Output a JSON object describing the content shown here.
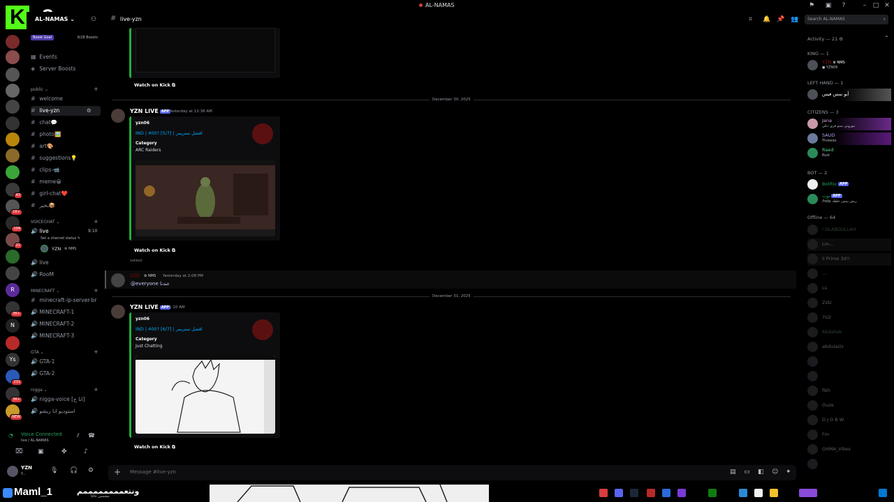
{
  "app": {
    "window_title": "AL-NAMAS",
    "overlay_logo_letter": "K",
    "overlay_logo_number": "8"
  },
  "server": {
    "name": "AL-NAMAS",
    "boost_goal": "Boost Goal",
    "boost_count": "9/28 Boosts",
    "top_links": [
      "Events",
      "Server Boosts"
    ]
  },
  "sidebar": {
    "categories": {
      "public": "public",
      "voicechat": "VOICECHAT",
      "minecraft": "MINECRAFT",
      "gta": "GTA",
      "nigga": "nigga"
    },
    "public_channels": [
      "welcome",
      "live-yzn",
      "chat💬",
      "photo🖼️",
      "art🎨",
      "suggestions💡",
      "clips-📹",
      "meme😀",
      "girl-chat❤️",
      "ـخبر📦"
    ],
    "voice_live": {
      "name": "live",
      "time": "9:10",
      "status": "Set a channel status",
      "member": "YZN",
      "member_tag": "NMS"
    },
    "voice_extra": [
      "live",
      "RooM"
    ],
    "minecraft_channels": [
      "minecraft-ip-server-br",
      "MINECRAFT-1",
      "MINECRAFT-2",
      "MINECRAFT-3"
    ],
    "gta_channels": [
      "GTA-1",
      "GTA-2"
    ],
    "nigga_channels": [
      "nigga-voice [انا ج]",
      "استوديو انا ريشو"
    ]
  },
  "voice_panel": {
    "status": "Voice Connected",
    "location": "live / AL-NAMAS"
  },
  "user_card": {
    "name": "YZN",
    "sub": "Y..."
  },
  "rail_badges": [
    "43",
    "1K+",
    "104",
    "21",
    "3K+",
    "1K+",
    "3K+",
    "231",
    "NEW"
  ],
  "rail_letters": [
    "R",
    "N",
    "Ys"
  ],
  "chat": {
    "channel": "live-yzn",
    "composer_placeholder": "Message #live-yzn",
    "watch_label": "Watch on Kick",
    "edited": "(edited)",
    "divider_1": "December 30, 2025",
    "divider_2": "December 31, 2025",
    "msg1": {
      "author": "YZN LIVE",
      "app_tag": "APP",
      "time": "Yesterday at 12:38 AM",
      "embed_channel": "yzn06",
      "embed_title": "IND | 400? [5/7] | افشل ستريمر",
      "category_label": "Category",
      "category": "ARC Raiders"
    },
    "msg2": {
      "author_tag": "NMS",
      "time": "Yesterday at 2:08 PM",
      "text": "@everyone عندنا"
    },
    "msg3": {
      "author": "YZN LIVE",
      "app_tag": "APP",
      "time": "1:10 AM",
      "embed_channel": "yzn06",
      "embed_title": "IND | 400? [6/7] | افشل ستريمر",
      "category_label": "Category",
      "category": "Just Chatting"
    }
  },
  "members": {
    "search_placeholder": "Search AL-NAMAS",
    "activity": "Activity — 21",
    "groups": {
      "king": "KING — 1",
      "left_hand": "LEFT HAND — 1",
      "citizens": "CITIZENS — 3",
      "bot": "BOT — 2",
      "offline": "Offline — 64"
    },
    "king": [
      {
        "name": "YZN",
        "tag": "NMS",
        "sub": "YZN06"
      }
    ],
    "left_hand": [
      {
        "name": "أبو نمس فيس",
        "sub": ""
      }
    ],
    "citizens": [
      {
        "name": "Jana",
        "sub": "موروني سنو فري دبلي"
      },
      {
        "name": "SAUD",
        "sub": "Threeoo"
      },
      {
        "name": "Raed",
        "sub": "Rust"
      }
    ],
    "bots": [
      {
        "name": "BotRix",
        "tag": "APP",
        "sub": ""
      },
      {
        "name": "بوت",
        "tag": "APP",
        "sub": "/help ريش بيتس خلقك"
      }
    ],
    "offline": [
      "I OLABDULLAH",
      "Lm...",
      "Ii Prime 3d!!",
      "...",
      "Ls",
      "Zidz",
      "7U2",
      "Abdallah",
      "abdulaziz",
      "",
      "",
      "fikh",
      "Ouze",
      "D J O B W",
      "Fm",
      "GHMA_Vibes",
      ""
    ]
  },
  "taskbar": {
    "user_label": "Maml_1",
    "user_ar": "ونتعممممممممم",
    "user_ar_sub": "مشمس غالبًا"
  },
  "colors": {
    "embed_accent": "#21b03a",
    "kick_green": "#53fc18",
    "link_blue": "#00a8fc",
    "app_tag": "#5865f2",
    "voice_green": "#23a55a"
  }
}
